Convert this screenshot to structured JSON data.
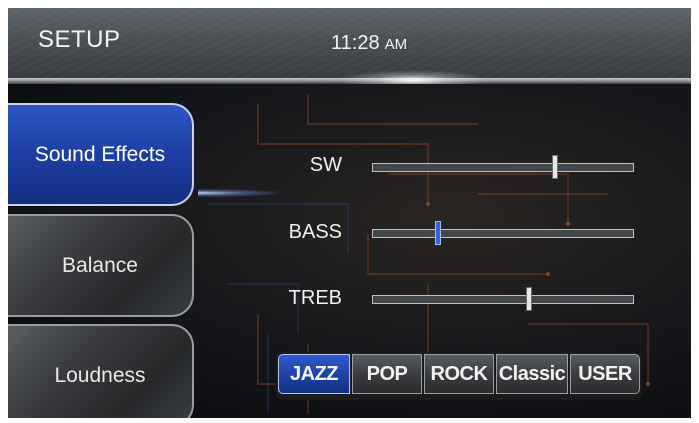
{
  "header": {
    "title": "SETUP",
    "time": "11:28",
    "ampm": "AM"
  },
  "tabs": [
    {
      "label": "Sound Effects",
      "selected": true
    },
    {
      "label": "Balance",
      "selected": false
    },
    {
      "label": "Loudness",
      "selected": false
    }
  ],
  "sliders": [
    {
      "label": "SW",
      "level": 0.7,
      "thumb_color": "#e8e8e8"
    },
    {
      "label": "BASS",
      "level": 0.25,
      "thumb_color": "#2f63e3"
    },
    {
      "label": "TREB",
      "level": 0.6,
      "thumb_color": "#e8e8e8"
    }
  ],
  "presets": [
    {
      "label": "JAZZ",
      "selected": true
    },
    {
      "label": "POP",
      "selected": false
    },
    {
      "label": "ROCK",
      "selected": false
    },
    {
      "label": "Classic",
      "selected": false
    },
    {
      "label": "USER",
      "selected": false
    }
  ],
  "colors": {
    "accent_blue": "#1d3fa4",
    "circuit_orange": "#b5502a"
  }
}
